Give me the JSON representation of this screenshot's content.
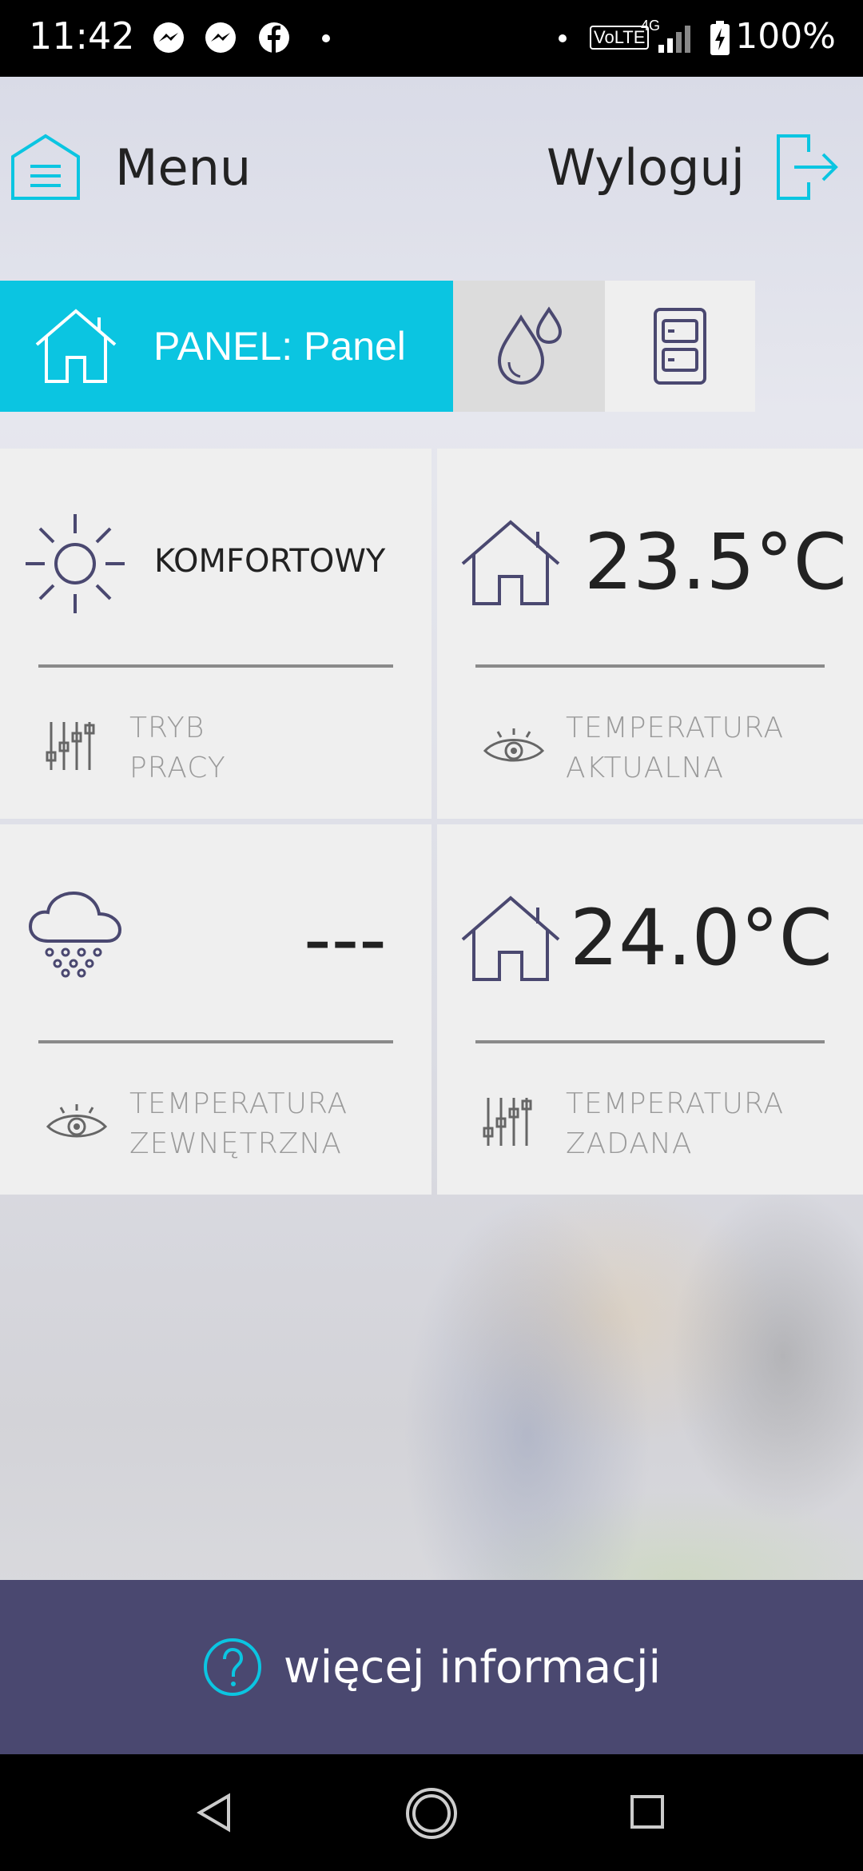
{
  "status_bar": {
    "time": "11:42",
    "battery": "100%",
    "network": "4G",
    "volte": "VoLTE",
    "notification_icons": [
      "messenger-icon",
      "messenger-icon",
      "facebook-icon",
      "dot-icon"
    ]
  },
  "header": {
    "menu_label": "Menu",
    "logout_label": "Wyloguj"
  },
  "tabs": [
    {
      "label": "PANEL: Panel",
      "icon": "home-icon",
      "active": true
    },
    {
      "label": "",
      "icon": "water-drops-icon",
      "active": false
    },
    {
      "label": "",
      "icon": "device-icon",
      "active": false
    }
  ],
  "tiles": {
    "mode": {
      "value": "KOMFORTOWY",
      "label_line1": "TRYB",
      "label_line2": "PRACY",
      "icon": "sun-icon",
      "sub_icon": "sliders-icon"
    },
    "current_temp": {
      "value": "23.5°C",
      "label_line1": "TEMPERATURA",
      "label_line2": "AKTUALNA",
      "icon": "home-icon",
      "sub_icon": "eye-icon"
    },
    "outside_temp": {
      "value": "---",
      "label_line1": "TEMPERATURA",
      "label_line2": "ZEWNĘTRZNA",
      "icon": "snow-cloud-icon",
      "sub_icon": "eye-icon"
    },
    "set_temp": {
      "value": "24.0°C",
      "label_line1": "TEMPERATURA",
      "label_line2": "ZADANA",
      "icon": "home-icon",
      "sub_icon": "sliders-icon"
    }
  },
  "footer": {
    "more_info_label": "więcej informacji"
  },
  "colors": {
    "accent": "#0bc5e1",
    "footer_bg": "#4a4870",
    "icon_stroke": "#4a4870"
  }
}
